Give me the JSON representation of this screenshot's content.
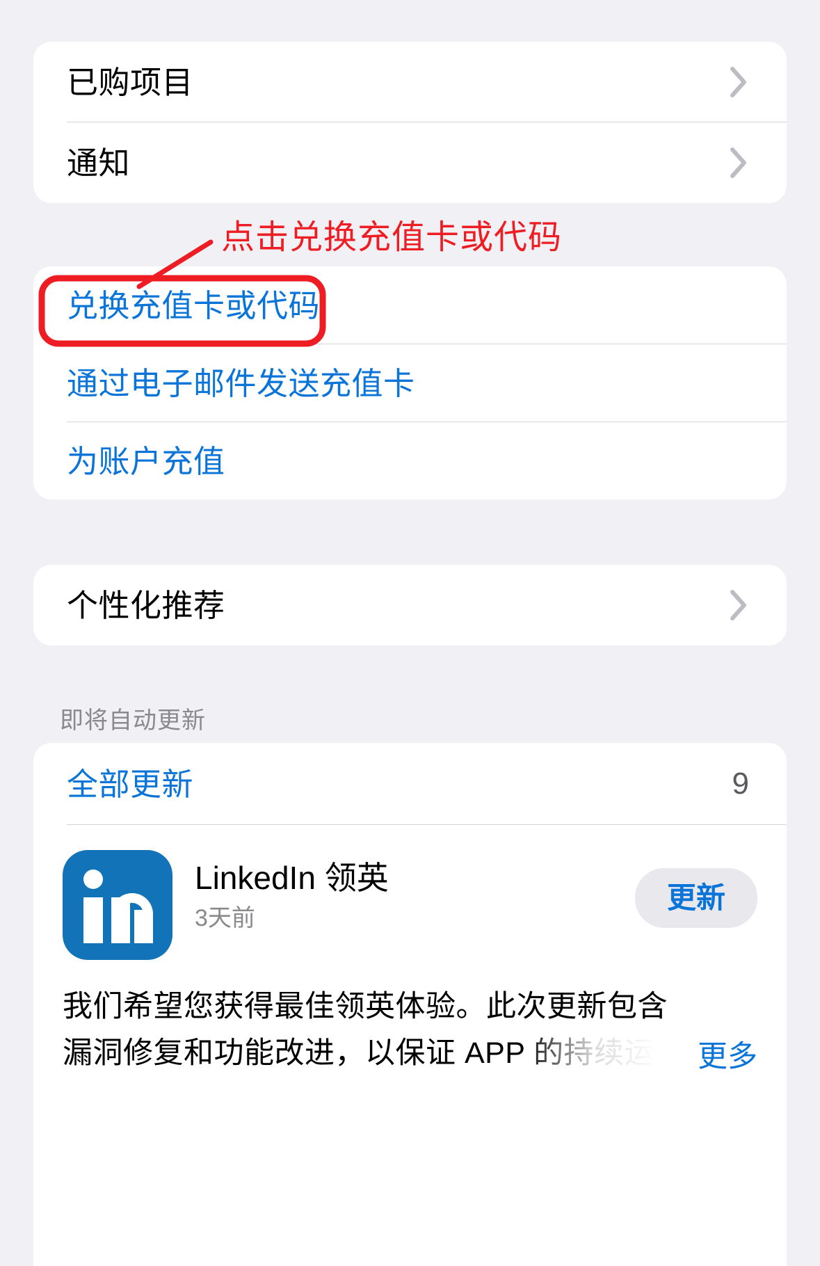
{
  "theme": {
    "page_bg": "#f1f1f5",
    "card_bg": "#ffffff",
    "link_blue": "#0a74d8",
    "annotation_red": "#ee1c23",
    "secondary_text": "#8a8a8e",
    "linkedin_blue": "#1273b8"
  },
  "section_account": {
    "rows": [
      {
        "label": "已购项目",
        "accessory": "chevron-right"
      },
      {
        "label": "通知",
        "accessory": "chevron-right"
      }
    ]
  },
  "section_giftcards": {
    "rows": [
      {
        "label": "兑换充值卡或代码",
        "style": "link",
        "highlighted": true
      },
      {
        "label": "通过电子邮件发送充值卡",
        "style": "link",
        "highlighted": false
      },
      {
        "label": "为账户充值",
        "style": "link",
        "highlighted": false
      }
    ]
  },
  "section_personalization": {
    "rows": [
      {
        "label": "个性化推荐",
        "accessory": "chevron-right"
      }
    ]
  },
  "section_updates": {
    "header": "即将自动更新",
    "update_all": {
      "label": "全部更新",
      "count": "9"
    },
    "apps": [
      {
        "name": "LinkedIn 领英",
        "icon": "linkedin-icon",
        "time": "3天前",
        "button": "更新",
        "notes": "我们希望您获得最佳领英体验。此次更新包含漏洞修复和功能改进，以保证 APP 的持续运行。",
        "more": "更多"
      }
    ]
  },
  "annotation": {
    "text": "点击兑换充值卡或代码",
    "color": "#ee1c23",
    "arrow": "callout-arrow",
    "highlight_box": "redeem-row-highlight"
  }
}
